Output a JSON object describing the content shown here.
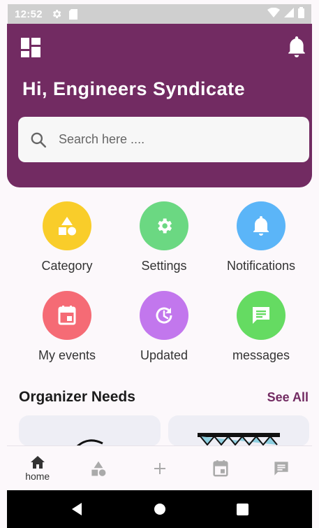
{
  "status_bar": {
    "time": "12:52"
  },
  "header": {
    "greeting": "Hi, Engineers Syndicate",
    "search_placeholder": "Search here ...."
  },
  "tiles": [
    {
      "label": "Category",
      "icon": "shapes-icon",
      "color": "#f9cd2a"
    },
    {
      "label": "Settings",
      "icon": "gear-icon",
      "color": "#6bd882"
    },
    {
      "label": "Notifications",
      "icon": "bell-icon",
      "color": "#5bb5f8"
    },
    {
      "label": "My events",
      "icon": "calendar-icon",
      "color": "#f56b75"
    },
    {
      "label": "Updated",
      "icon": "update-icon",
      "color": "#c277ed"
    },
    {
      "label": "messages",
      "icon": "message-icon",
      "color": "#65db62"
    }
  ],
  "section": {
    "title": "Organizer Needs",
    "see_all": "See All"
  },
  "bottom_nav": {
    "home_label": "home"
  },
  "colors": {
    "primary": "#722b62",
    "background": "#fcf8fb"
  }
}
